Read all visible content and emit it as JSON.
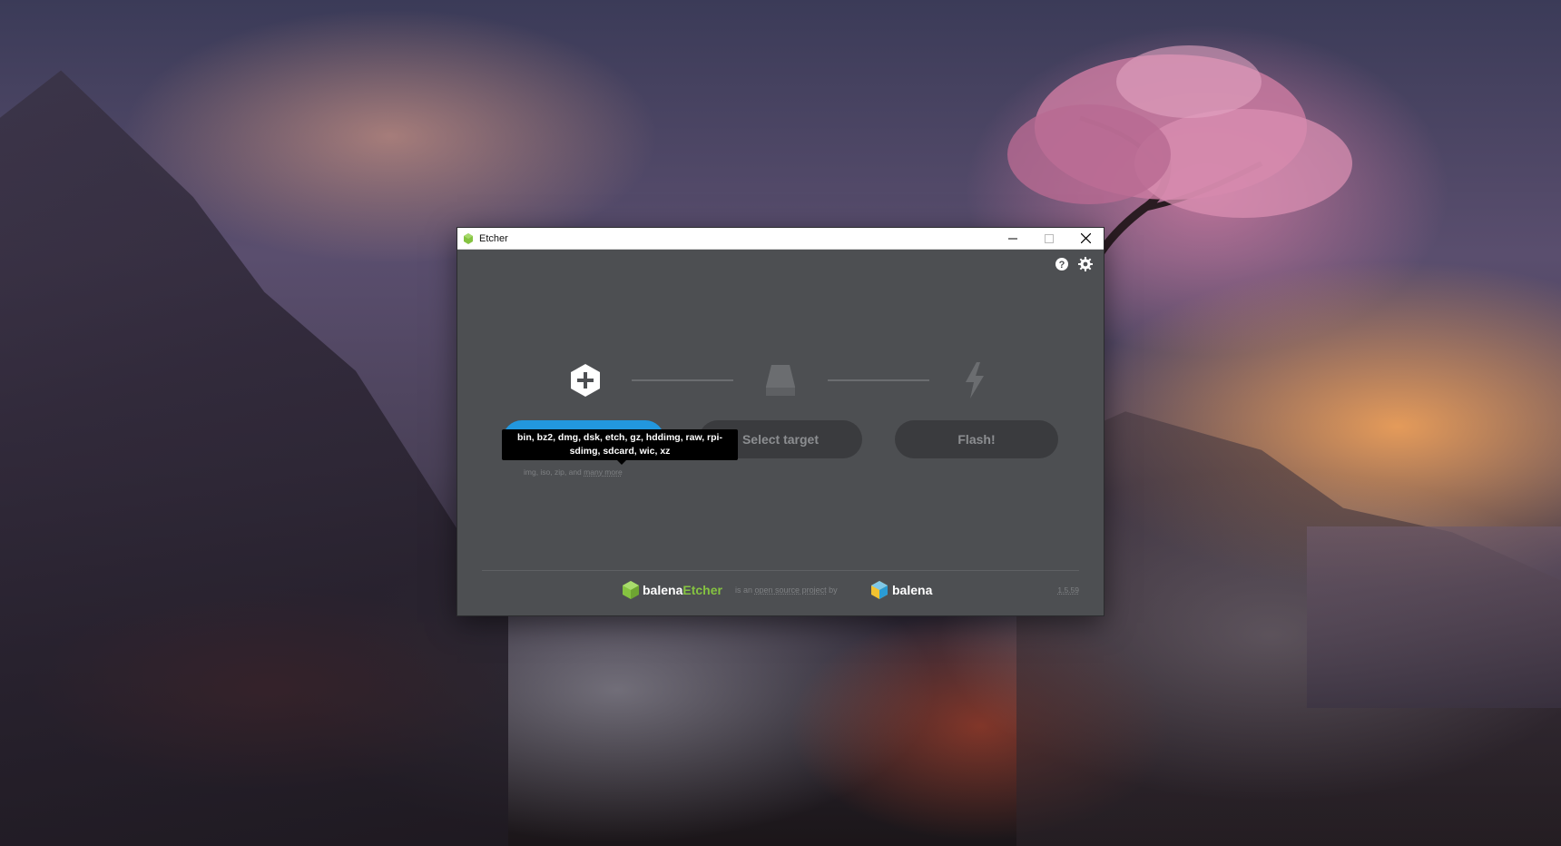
{
  "window": {
    "title": "Etcher",
    "controls": [
      "minimize",
      "maximize",
      "close"
    ]
  },
  "toolbar": {
    "help_icon": "help-circle-icon",
    "settings_icon": "gear-icon"
  },
  "steps": {
    "image": {
      "icon": "plus-hexagon-icon",
      "button_label": "Select image"
    },
    "target": {
      "icon": "drive-icon",
      "button_label": "Select target"
    },
    "flash": {
      "icon": "lightning-icon",
      "button_label": "Flash!"
    }
  },
  "tooltip": {
    "line1": "bin, bz2, dmg, dsk, etch, gz, hddimg, raw, rpi-",
    "line2": "sdimg, sdcard, wic, xz"
  },
  "formats_note": {
    "prefix": "img, iso, zip, and",
    "more": "many more"
  },
  "footer": {
    "brand_part1": "balena",
    "brand_part2": "Etcher",
    "is_an": "is an",
    "open_source_project": "open source project",
    "by": "by",
    "company": "balena",
    "version": "1.5.59"
  },
  "colors": {
    "primary": "#2297de",
    "accent_green": "#85c341",
    "window_bg": "#4d4f52",
    "disabled_button": "#3a3b3e"
  }
}
